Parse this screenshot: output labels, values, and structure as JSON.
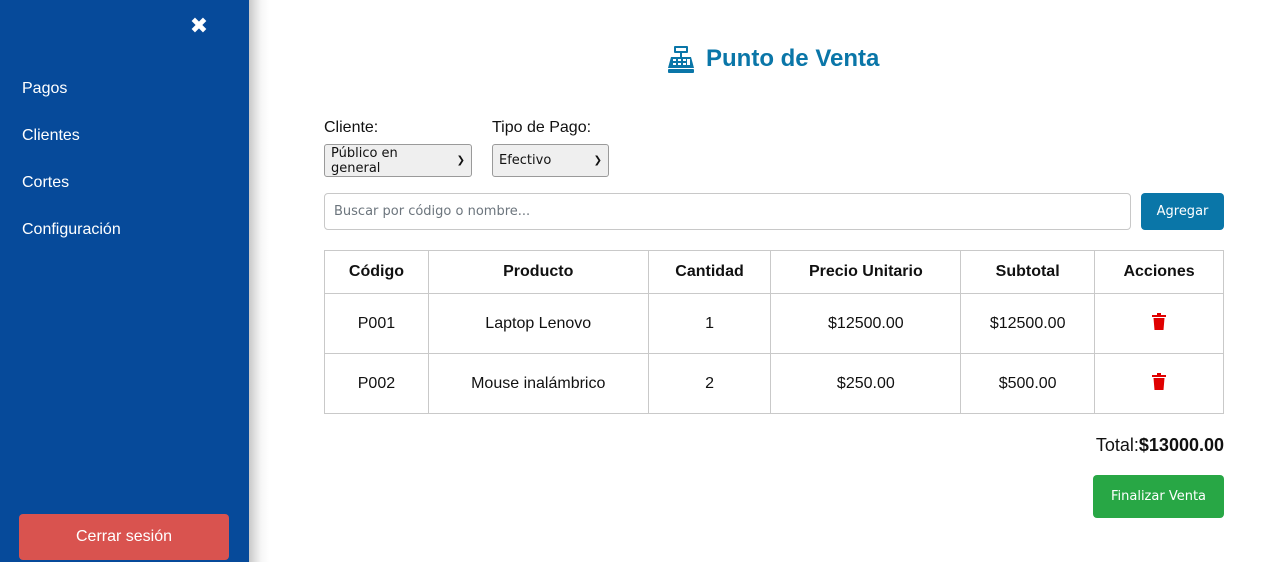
{
  "sidebar": {
    "close_icon": "close-icon",
    "items": [
      {
        "label": "Pagos"
      },
      {
        "label": "Clientes"
      },
      {
        "label": "Cortes"
      },
      {
        "label": "Configuración"
      }
    ],
    "logout_label": "Cerrar sesión"
  },
  "header": {
    "icon": "cash-register-icon",
    "title": "Punto de Venta"
  },
  "form": {
    "cliente_label": "Cliente:",
    "cliente_value": "Público en general",
    "tipo_pago_label": "Tipo de Pago:",
    "tipo_pago_value": "Efectivo",
    "search_placeholder": "Buscar por código o nombre...",
    "add_label": "Agregar"
  },
  "table": {
    "headers": [
      "Código",
      "Producto",
      "Cantidad",
      "Precio Unitario",
      "Subtotal",
      "Acciones"
    ],
    "rows": [
      {
        "codigo": "P001",
        "producto": "Laptop Lenovo",
        "cantidad": "1",
        "precio": "$12500.00",
        "subtotal": "$12500.00",
        "action_icon": "trash-icon"
      },
      {
        "codigo": "P002",
        "producto": "Mouse inalámbrico",
        "cantidad": "2",
        "precio": "$250.00",
        "subtotal": "$500.00",
        "action_icon": "trash-icon"
      }
    ]
  },
  "summary": {
    "total_label": "Total:",
    "total_value": "$13000.00",
    "finish_label": "Finalizar Venta"
  },
  "colors": {
    "sidebar_bg": "#064a9a",
    "accent": "#0a76a8",
    "danger": "#d9534f",
    "success": "#28a745",
    "trash": "#e00000"
  }
}
